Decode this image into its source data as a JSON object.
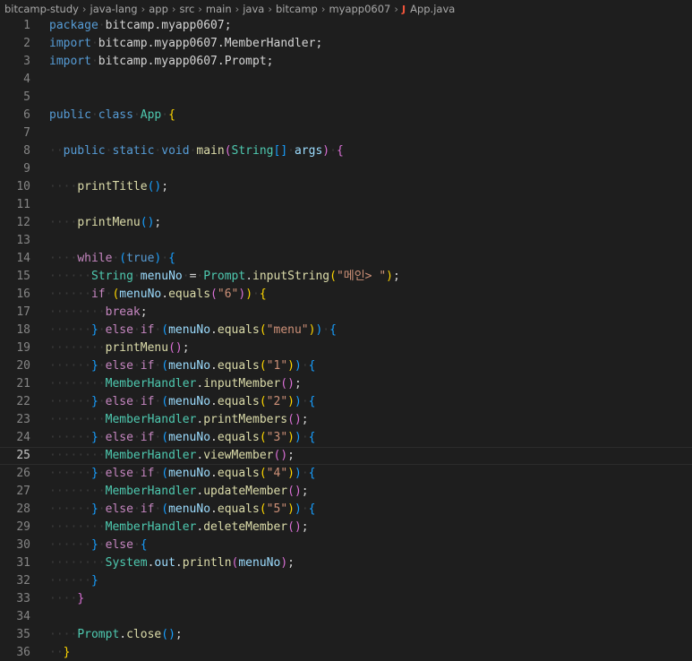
{
  "breadcrumb": {
    "items": [
      "bitcamp-study",
      "java-lang",
      "app",
      "src",
      "main",
      "java",
      "bitcamp",
      "myapp0607"
    ],
    "separator": "›",
    "file_icon": "J",
    "file_name": "App.java"
  },
  "editor": {
    "language": "java",
    "active_line": 25,
    "lines": [
      {
        "n": "1",
        "t": "package bitcamp.myapp0607;"
      },
      {
        "n": "2",
        "t": "import bitcamp.myapp0607.MemberHandler;"
      },
      {
        "n": "3",
        "t": "import bitcamp.myapp0607.Prompt;"
      },
      {
        "n": "4",
        "t": ""
      },
      {
        "n": "5",
        "t": ""
      },
      {
        "n": "6",
        "t": "public class App {"
      },
      {
        "n": "7",
        "t": ""
      },
      {
        "n": "8",
        "t": "  public static void main(String[] args) {"
      },
      {
        "n": "9",
        "t": ""
      },
      {
        "n": "10",
        "t": "    printTitle();"
      },
      {
        "n": "11",
        "t": ""
      },
      {
        "n": "12",
        "t": "    printMenu();"
      },
      {
        "n": "13",
        "t": ""
      },
      {
        "n": "14",
        "t": "    while (true) {"
      },
      {
        "n": "15",
        "t": "      String menuNo = Prompt.inputString(\"메인> \");"
      },
      {
        "n": "16",
        "t": "      if (menuNo.equals(\"6\")) {"
      },
      {
        "n": "17",
        "t": "        break;"
      },
      {
        "n": "18",
        "t": "      } else if (menuNo.equals(\"menu\")) {"
      },
      {
        "n": "19",
        "t": "        printMenu();"
      },
      {
        "n": "20",
        "t": "      } else if (menuNo.equals(\"1\")) {"
      },
      {
        "n": "21",
        "t": "        MemberHandler.inputMember();"
      },
      {
        "n": "22",
        "t": "      } else if (menuNo.equals(\"2\")) {"
      },
      {
        "n": "23",
        "t": "        MemberHandler.printMembers();"
      },
      {
        "n": "24",
        "t": "      } else if (menuNo.equals(\"3\")) {"
      },
      {
        "n": "25",
        "t": "        MemberHandler.viewMember();"
      },
      {
        "n": "26",
        "t": "      } else if (menuNo.equals(\"4\")) {"
      },
      {
        "n": "27",
        "t": "        MemberHandler.updateMember();"
      },
      {
        "n": "28",
        "t": "      } else if (menuNo.equals(\"5\")) {"
      },
      {
        "n": "29",
        "t": "        MemberHandler.deleteMember();"
      },
      {
        "n": "30",
        "t": "      } else {"
      },
      {
        "n": "31",
        "t": "        System.out.println(menuNo);"
      },
      {
        "n": "32",
        "t": "      }"
      },
      {
        "n": "33",
        "t": "    }"
      },
      {
        "n": "34",
        "t": ""
      },
      {
        "n": "35",
        "t": "    Prompt.close();"
      },
      {
        "n": "36",
        "t": "  }"
      }
    ]
  }
}
